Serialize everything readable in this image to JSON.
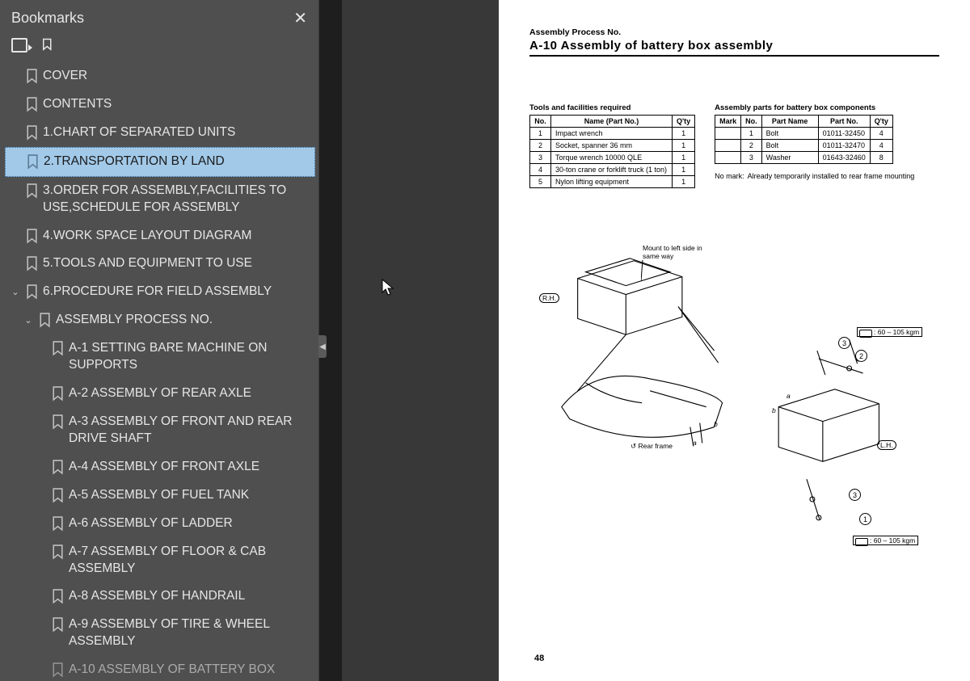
{
  "sidebar": {
    "title": "Bookmarks",
    "items": [
      {
        "label": "COVER",
        "indent": 0
      },
      {
        "label": "CONTENTS",
        "indent": 0
      },
      {
        "label": "1.CHART OF SEPARATED UNITS",
        "indent": 0
      },
      {
        "label": "2.TRANSPORTATION BY LAND",
        "indent": 0,
        "selected": true
      },
      {
        "label": "3.ORDER FOR ASSEMBLY,FACILITIES TO USE,SCHEDULE FOR ASSEMBLY",
        "indent": 0
      },
      {
        "label": "4.WORK SPACE LAYOUT DIAGRAM",
        "indent": 0
      },
      {
        "label": "5.TOOLS AND EQUIPMENT TO USE",
        "indent": 0
      },
      {
        "label": "6.PROCEDURE FOR FIELD ASSEMBLY",
        "indent": 0,
        "expand": true
      },
      {
        "label": "ASSEMBLY PROCESS NO.",
        "indent": 1,
        "expand": true
      },
      {
        "label": "A-1 SETTING BARE MACHINE ON SUPPORTS",
        "indent": 2
      },
      {
        "label": "A-2 ASSEMBLY OF REAR AXLE",
        "indent": 2
      },
      {
        "label": "A-3 ASSEMBLY OF FRONT AND REAR DRIVE SHAFT",
        "indent": 2
      },
      {
        "label": "A-4 ASSEMBLY OF FRONT AXLE",
        "indent": 2
      },
      {
        "label": "A-5 ASSEMBLY OF FUEL TANK",
        "indent": 2
      },
      {
        "label": "A-6 ASSEMBLY OF LADDER",
        "indent": 2
      },
      {
        "label": "A-7 ASSEMBLY OF FLOOR & CAB ASSEMBLY",
        "indent": 2
      },
      {
        "label": "A-8 ASSEMBLY OF HANDRAIL",
        "indent": 2
      },
      {
        "label": "A-9 ASSEMBLY OF TIRE & WHEEL ASSEMBLY",
        "indent": 2
      },
      {
        "label": "A-10 ASSEMBLY OF BATTERY BOX",
        "indent": 2
      }
    ]
  },
  "page": {
    "header_small": "Assembly Process No.",
    "header_big": "A-10  Assembly of battery box assembly",
    "tools_caption": "Tools and facilities required",
    "tools_headers": {
      "no": "No.",
      "name": "Name (Part No.)",
      "qty": "Q'ty"
    },
    "tools_rows": [
      {
        "no": "1",
        "name": "Impact wrench",
        "qty": "1"
      },
      {
        "no": "2",
        "name": "Socket, spanner 36 mm",
        "qty": "1"
      },
      {
        "no": "3",
        "name": "Torque wrench 10000 QLE",
        "qty": "1"
      },
      {
        "no": "4",
        "name": "30-ton crane or forklift truck (1 ton)",
        "qty": "1"
      },
      {
        "no": "5",
        "name": "Nylon lifting equipment",
        "qty": "1"
      }
    ],
    "parts_caption": "Assembly parts for battery box components",
    "parts_headers": {
      "mark": "Mark",
      "no": "No.",
      "name": "Part Name",
      "partno": "Part No.",
      "qty": "Q'ty"
    },
    "parts_rows": [
      {
        "mark": "",
        "no": "1",
        "name": "Bolt",
        "partno": "01011-32450",
        "qty": "4"
      },
      {
        "mark": "",
        "no": "2",
        "name": "Bolt",
        "partno": "01011-32470",
        "qty": "4"
      },
      {
        "mark": "",
        "no": "3",
        "name": "Washer",
        "partno": "01643-32460",
        "qty": "8"
      }
    ],
    "nomarks_k": "No mark:",
    "nomarks_v": "Already temporarily installed to rear frame mounting",
    "diagram": {
      "mount_label": "Mount to left side\nin same way",
      "rh": "R.H.",
      "lh": "L.H.",
      "rearframe": "Rear frame",
      "torque": ": 60 – 105 kgm",
      "letters": {
        "a": "a",
        "b": "b"
      }
    },
    "pagenum": "48"
  }
}
